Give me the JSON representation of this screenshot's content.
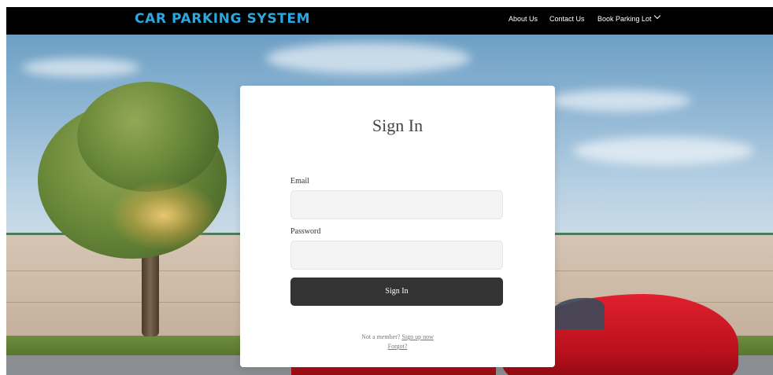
{
  "navbar": {
    "brand": "CAR PARKING SYSTEM",
    "links": [
      "About Us",
      "Contact Us",
      "Book Parking Lot"
    ]
  },
  "form": {
    "title": "Sign In",
    "email_label": "Email",
    "email_value": "",
    "password_label": "Password",
    "password_value": "",
    "submit_label": "Sign In",
    "not_member_text": "Not a member?",
    "signup_link": "Sign up now",
    "forgot_link": "Forgot?"
  },
  "colors": {
    "brand": "#29a8e0",
    "navbar_bg": "#000000",
    "button_bg": "#333333"
  },
  "icons": {
    "dropdown": "chevron-down-icon"
  }
}
